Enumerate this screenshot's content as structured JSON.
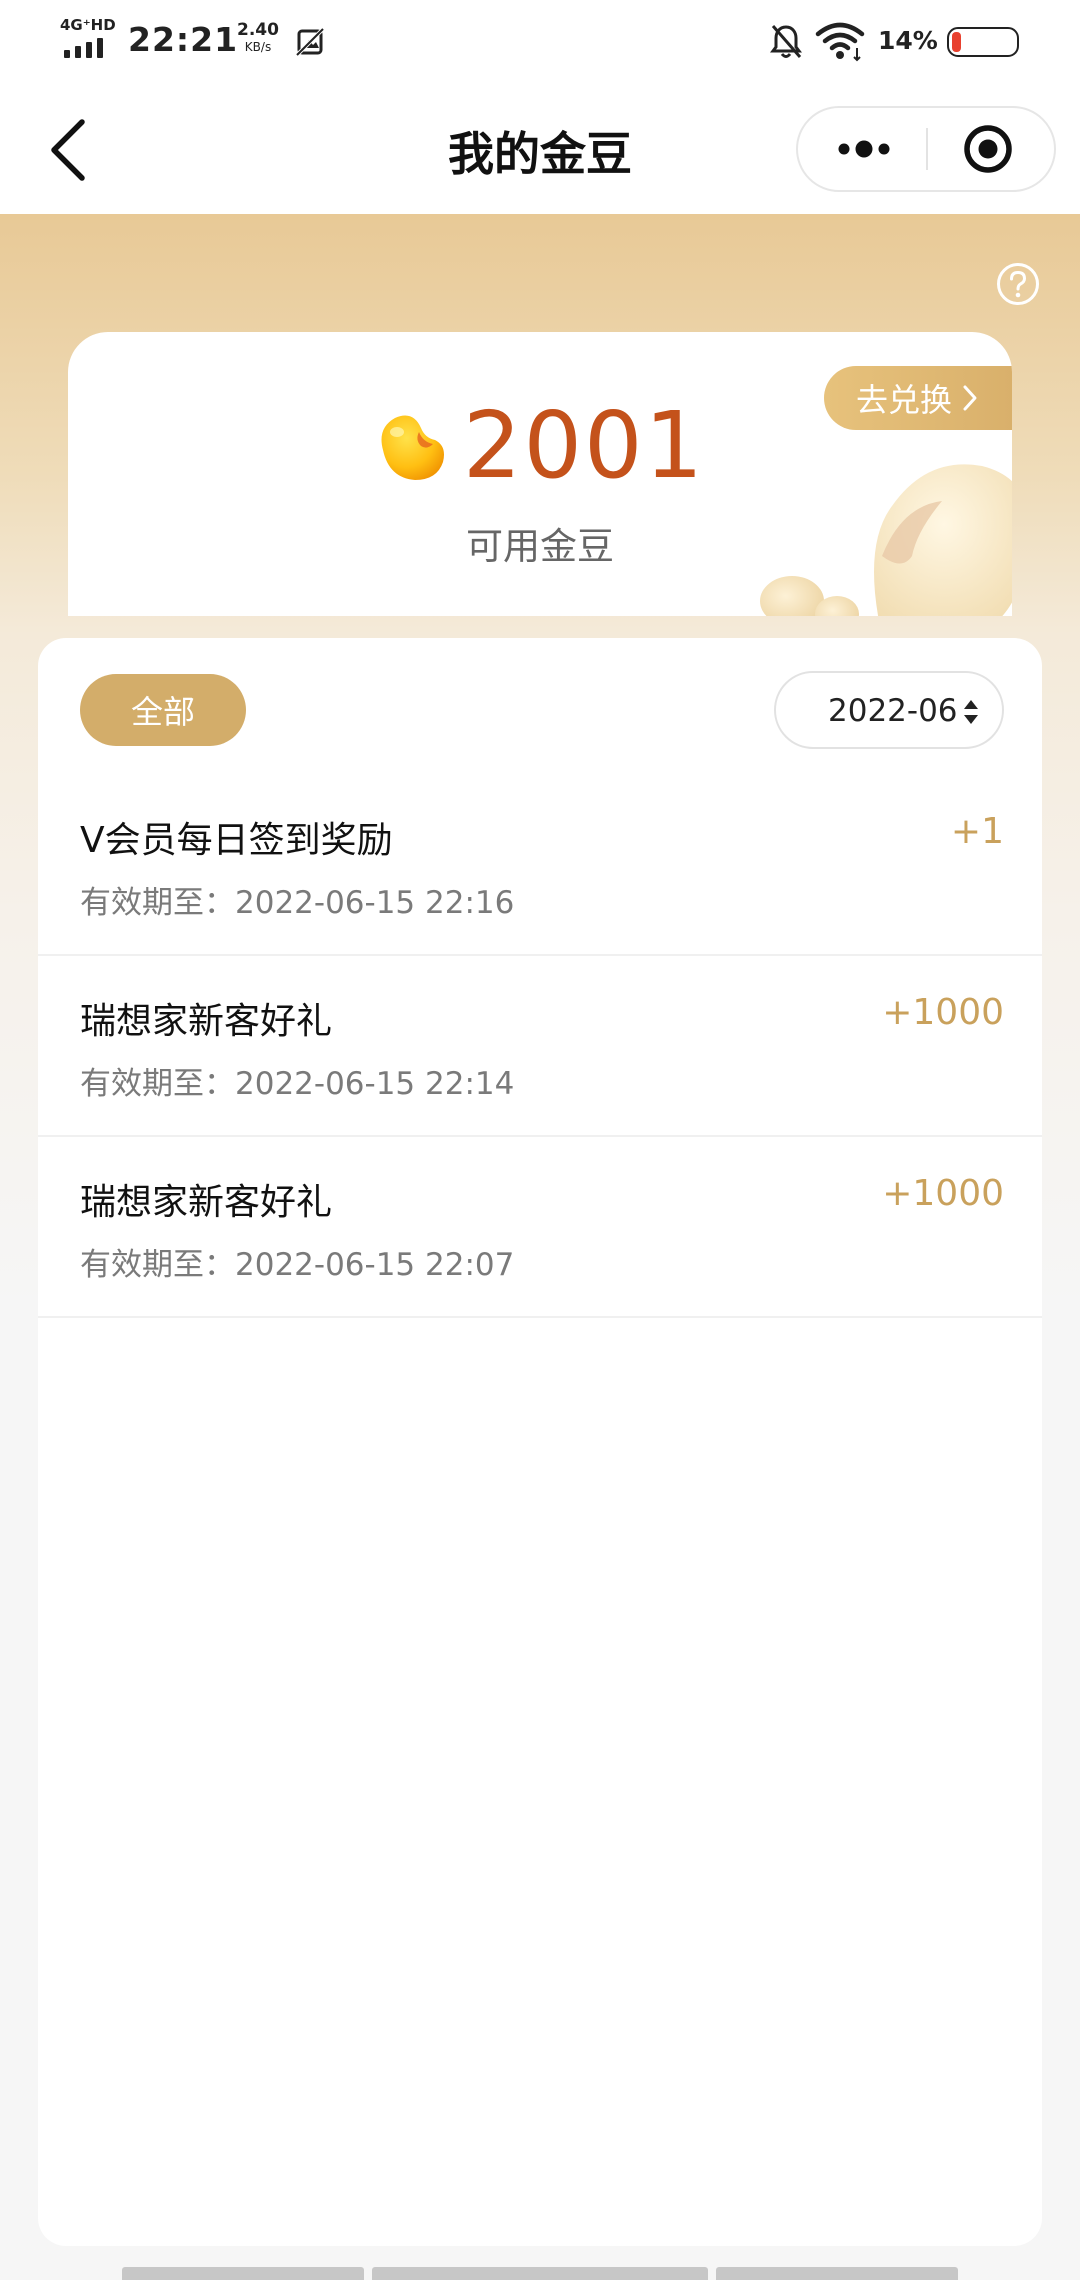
{
  "status_bar": {
    "network": "4G⁺HD",
    "time": "22:21",
    "speed_value": "2.40",
    "speed_unit": "KB/s",
    "battery_percent": "14%",
    "battery_color": "#e8412f"
  },
  "nav": {
    "title": "我的金豆",
    "back_icon": "chevron-left-icon",
    "more_icon": "more-dots-icon",
    "target_icon": "target-circle-icon"
  },
  "balance": {
    "value": "2001",
    "label": "可用金豆",
    "exchange_label": "去兑换",
    "value_color": "#c4521b"
  },
  "filter": {
    "all_label": "全部",
    "month_value": "2022-06"
  },
  "records": [
    {
      "title": "V会员每日签到奖励",
      "expire": "有效期至：2022-06-15 22:16",
      "amount": "+1"
    },
    {
      "title": "瑞想家新客好礼",
      "expire": "有效期至：2022-06-15 22:14",
      "amount": "+1000"
    },
    {
      "title": "瑞想家新客好礼",
      "expire": "有效期至：2022-06-15 22:07",
      "amount": "+1000"
    }
  ],
  "colors": {
    "accent_gold": "#d3ad6a",
    "amount_gold": "#c9a15c"
  }
}
